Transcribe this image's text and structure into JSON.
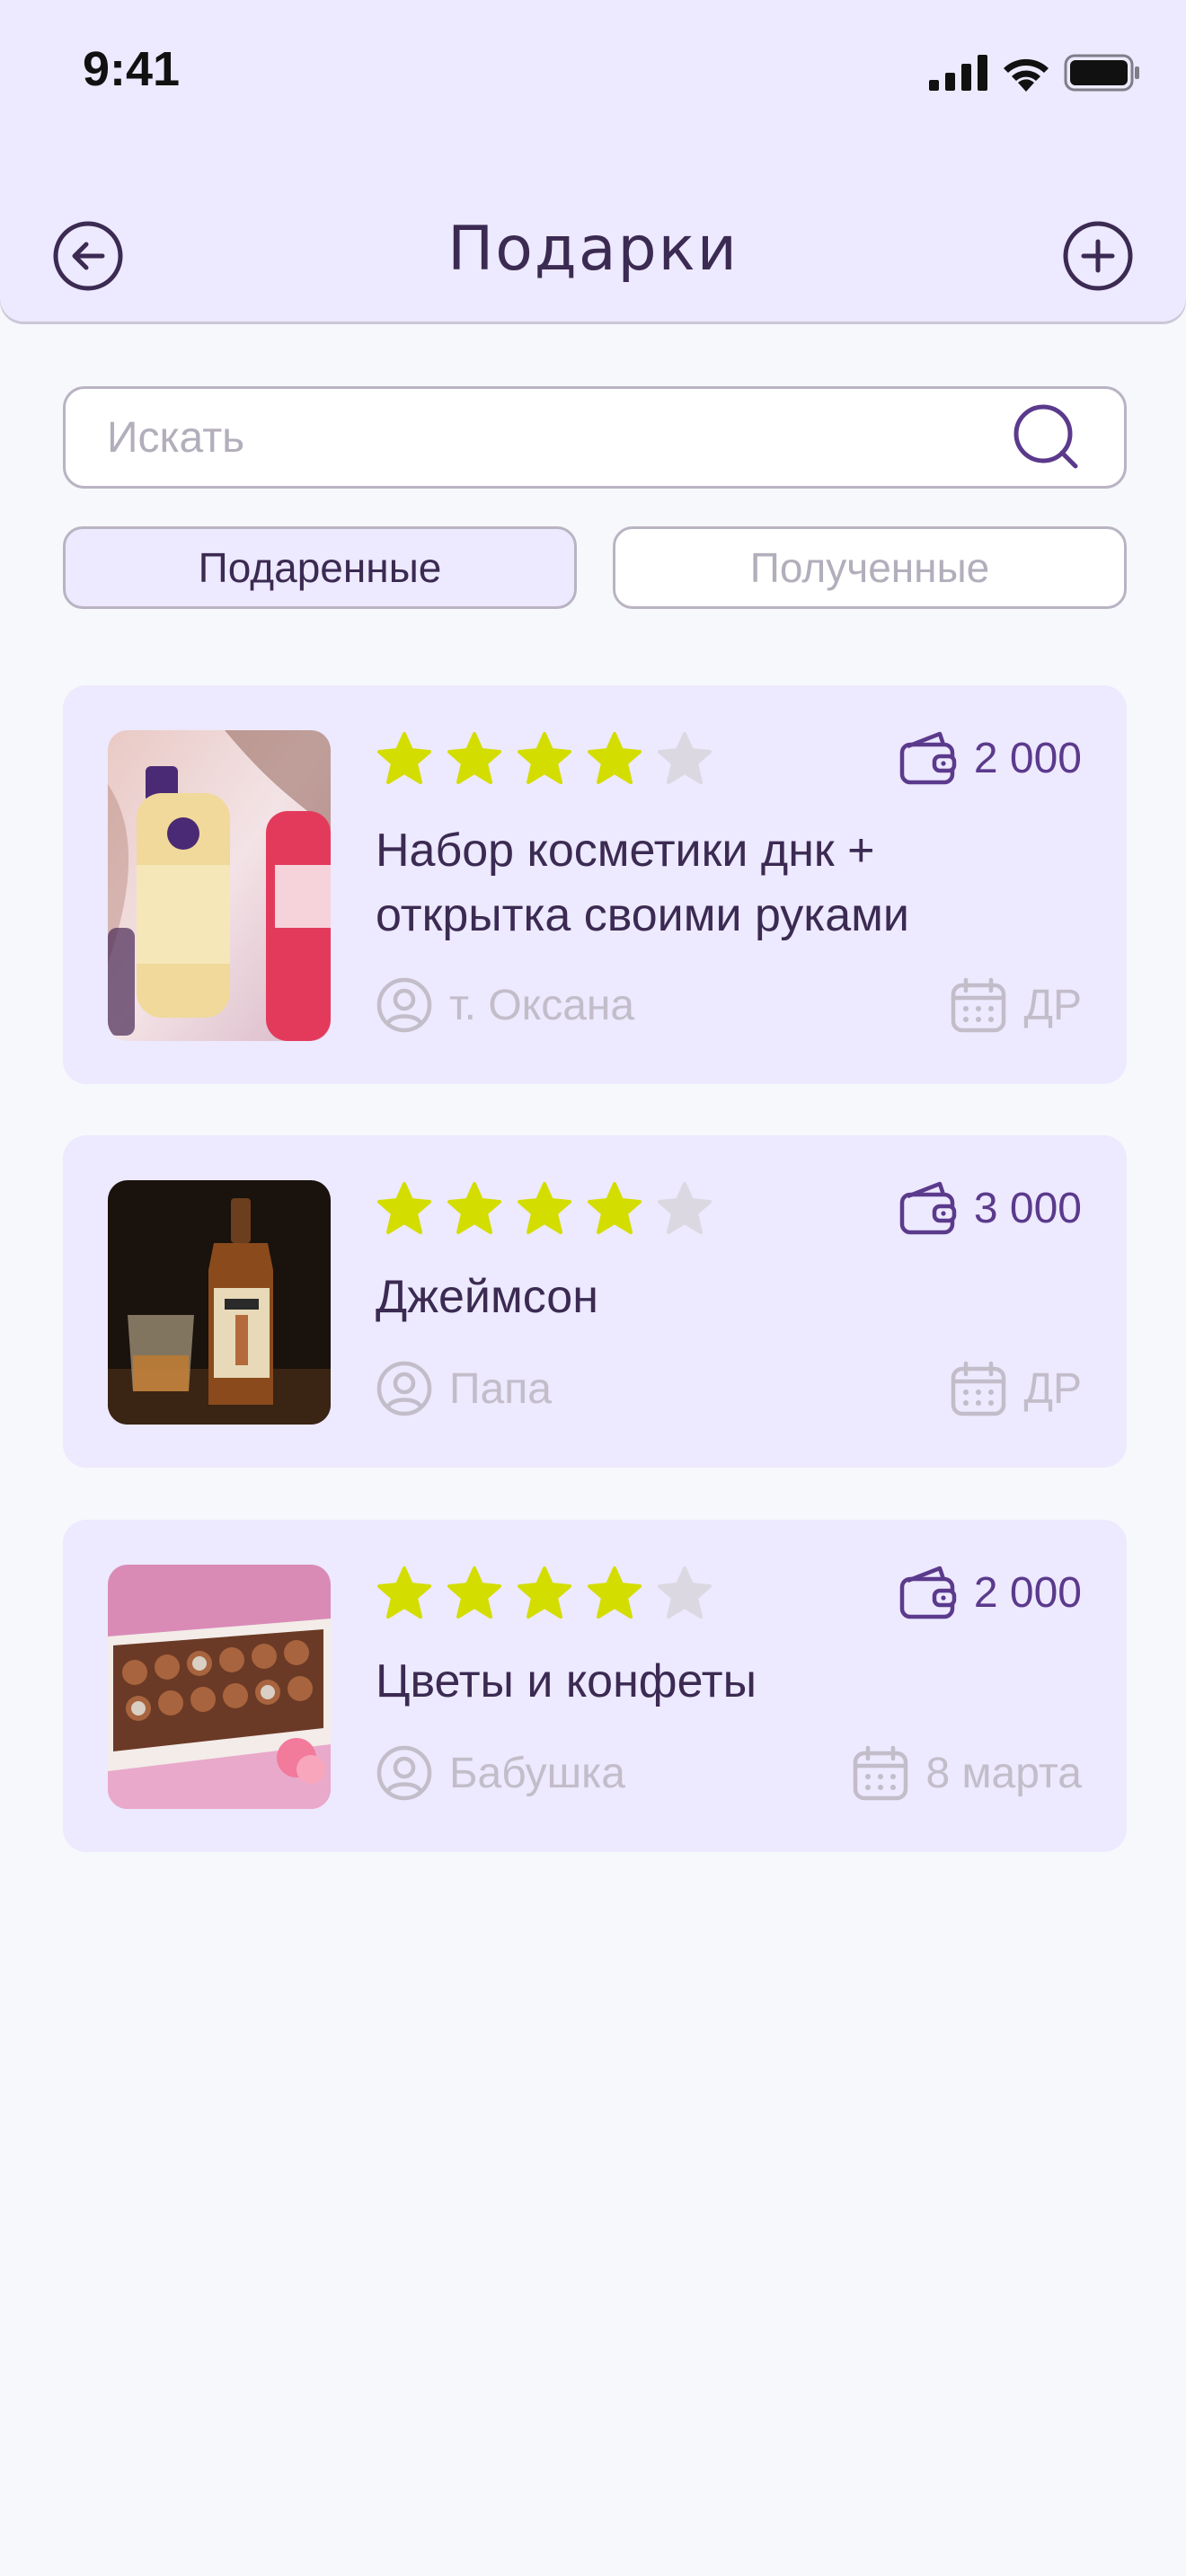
{
  "status_bar": {
    "time": "9:41"
  },
  "header": {
    "title": "Подарки"
  },
  "search": {
    "placeholder": "Искать"
  },
  "tabs": [
    {
      "label": "Подаренные",
      "active": true
    },
    {
      "label": "Полученные",
      "active": false
    }
  ],
  "gifts": [
    {
      "rating": 4,
      "max_rating": 5,
      "price": "2 000",
      "title_line1": "Набор косметики днк +",
      "title_line2": "открытка своими руками",
      "recipient": "т. Оксана",
      "occasion": "ДР",
      "image": "cosmetics-bottles-photo"
    },
    {
      "rating": 4,
      "max_rating": 5,
      "price": "3 000",
      "title_line1": "Джеймсон",
      "recipient": "Папа",
      "occasion": "ДР",
      "image": "whiskey-bottle-photo"
    },
    {
      "rating": 4,
      "max_rating": 5,
      "price": "2 000",
      "title_line1": "Цветы и конфеты",
      "recipient": "Бабушка",
      "occasion": "8 марта",
      "image": "chocolate-box-photo"
    }
  ],
  "colors": {
    "header_bg": "#EDE9FE",
    "card_bg": "#EDE9FE",
    "star_filled": "#D4DD00",
    "star_empty": "#DCD8E1",
    "accent": "#5B3A8C",
    "title_text": "#3B2A52",
    "muted_text": "#C2BDC9"
  },
  "icons": [
    "back-icon",
    "add-icon",
    "search-icon",
    "wallet-icon",
    "user-icon",
    "calendar-icon",
    "star-icon"
  ]
}
